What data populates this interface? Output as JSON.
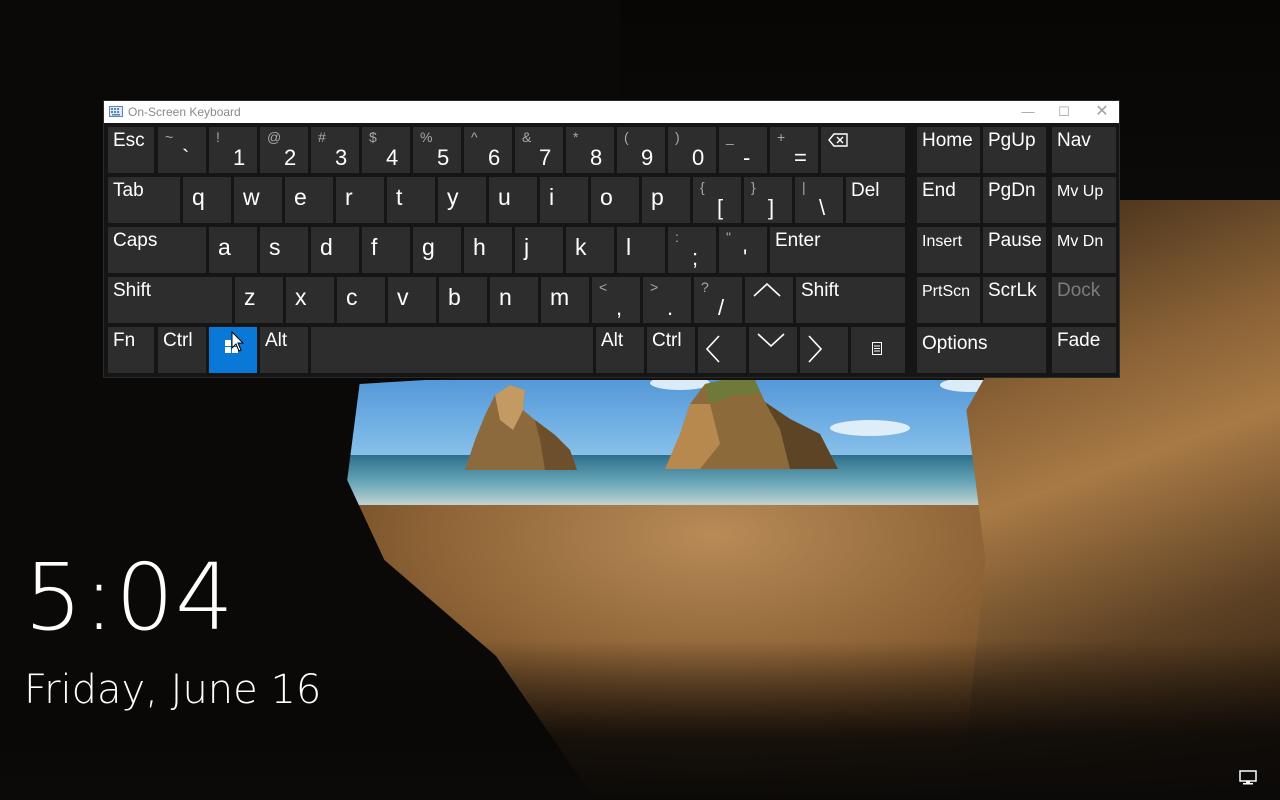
{
  "window": {
    "title": "On-Screen Keyboard",
    "minimize": "—",
    "maximize": "☐",
    "close": "✕"
  },
  "keys": {
    "row1": [
      {
        "label": "Esc"
      },
      {
        "shift": "~",
        "main": "`"
      },
      {
        "shift": "!",
        "main": "1"
      },
      {
        "shift": "@",
        "main": "2"
      },
      {
        "shift": "#",
        "main": "3"
      },
      {
        "shift": "$",
        "main": "4"
      },
      {
        "shift": "%",
        "main": "5"
      },
      {
        "shift": "^",
        "main": "6"
      },
      {
        "shift": "&",
        "main": "7"
      },
      {
        "shift": "*",
        "main": "8"
      },
      {
        "shift": "(",
        "main": "9"
      },
      {
        "shift": ")",
        "main": "0"
      },
      {
        "shift": "_",
        "main": "-"
      },
      {
        "shift": "+",
        "main": "="
      }
    ],
    "row2": [
      "Tab",
      "q",
      "w",
      "e",
      "r",
      "t",
      "y",
      "u",
      "i",
      "o",
      "p"
    ],
    "row2_brackets": [
      {
        "shift": "{",
        "main": "["
      },
      {
        "shift": "}",
        "main": "]"
      },
      {
        "shift": "|",
        "main": "\\"
      }
    ],
    "del": "Del",
    "row3": [
      "Caps",
      "a",
      "s",
      "d",
      "f",
      "g",
      "h",
      "j",
      "k",
      "l"
    ],
    "row3_punct": [
      {
        "shift": ":",
        "main": ";"
      },
      {
        "shift": "\"",
        "main": "'"
      }
    ],
    "enter": "Enter",
    "row4": [
      "Shift",
      "z",
      "x",
      "c",
      "v",
      "b",
      "n",
      "m"
    ],
    "row4_punct": [
      {
        "shift": "<",
        "main": ","
      },
      {
        "shift": ">",
        "main": "."
      },
      {
        "shift": "?",
        "main": "/"
      }
    ],
    "shift_right": "Shift",
    "row5": {
      "fn": "Fn",
      "ctrl_left": "Ctrl",
      "alt_left": "Alt",
      "alt_right": "Alt",
      "ctrl_right": "Ctrl"
    },
    "nav": {
      "home": "Home",
      "pgup": "PgUp",
      "nav": "Nav",
      "end": "End",
      "pgdn": "PgDn",
      "mvup": "Mv Up",
      "insert": "Insert",
      "pause": "Pause",
      "mvdn": "Mv Dn",
      "prtscn": "PrtScn",
      "scrlk": "ScrLk",
      "dock": "Dock",
      "options": "Options",
      "fade": "Fade"
    }
  },
  "lock_screen": {
    "time": "5:04",
    "date": "Friday, June 16"
  },
  "colors": {
    "key_bg": "#2d2d2d",
    "keyboard_bg": "#151515",
    "active_key": "#0a78d7"
  }
}
